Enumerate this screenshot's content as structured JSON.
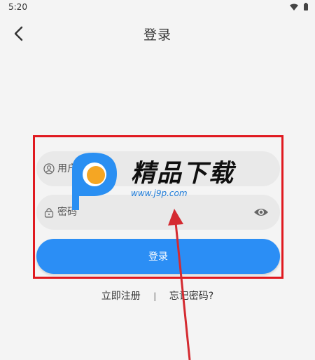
{
  "status_bar": {
    "time": "5:20",
    "icons": [
      "wifi-icon",
      "battery-icon"
    ]
  },
  "header": {
    "title": "登录",
    "back_icon": "chevron-left-icon"
  },
  "form": {
    "username_placeholder": "用户名",
    "password_placeholder": "密码",
    "login_button_label": "登录"
  },
  "links": {
    "register": "立即注册",
    "divider": "|",
    "forgot_password": "忘记密码?"
  },
  "watermark": {
    "brand": "精品下载",
    "url": "www.j9p.com"
  },
  "colors": {
    "accent": "#2b8ef5",
    "background": "#f4f4f4",
    "field_background": "#e9e9e9",
    "annotation_red": "#e0191f"
  }
}
